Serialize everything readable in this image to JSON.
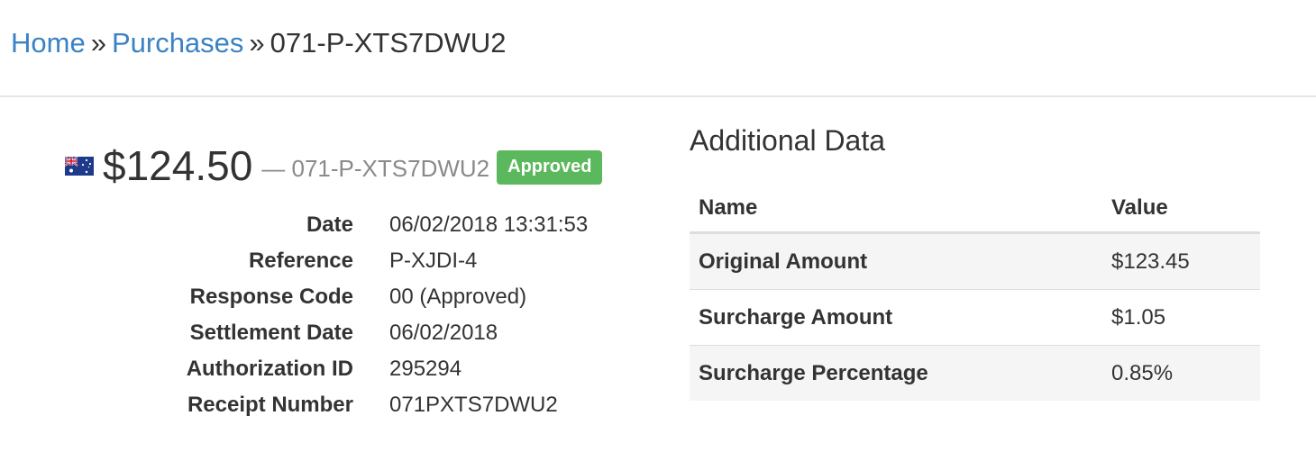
{
  "breadcrumb": {
    "home": "Home",
    "separator": "»",
    "purchases": "Purchases",
    "current": "071-P-XTS7DWU2"
  },
  "transaction": {
    "flag_icon": "australia-flag-icon",
    "amount": "$124.50",
    "reference_line": "— 071-P-XTS7DWU2",
    "status_badge": "Approved",
    "status_color": "#5cb85c"
  },
  "details": [
    {
      "label": "Date",
      "value": "06/02/2018 13:31:53"
    },
    {
      "label": "Reference",
      "value": "P-XJDI-4"
    },
    {
      "label": "Response Code",
      "value": "00 (Approved)"
    },
    {
      "label": "Settlement Date",
      "value": "06/02/2018"
    },
    {
      "label": "Authorization ID",
      "value": "295294"
    },
    {
      "label": "Receipt Number",
      "value": "071PXTS7DWU2"
    }
  ],
  "additional": {
    "title": "Additional Data",
    "columns": [
      "Name",
      "Value"
    ],
    "rows": [
      {
        "name": "Original Amount",
        "value": "$123.45"
      },
      {
        "name": "Surcharge Amount",
        "value": "$1.05"
      },
      {
        "name": "Surcharge Percentage",
        "value": "0.85%"
      }
    ]
  },
  "colors": {
    "link": "#3a82c4",
    "text": "#333333",
    "muted": "#8a8a8a",
    "stripe": "#f5f5f5"
  }
}
